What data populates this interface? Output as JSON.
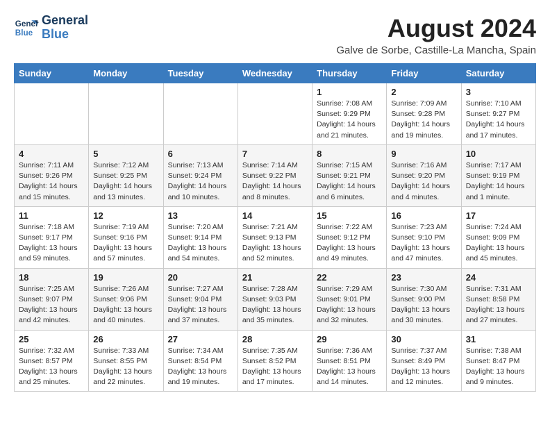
{
  "header": {
    "logo_line1": "General",
    "logo_line2": "Blue",
    "month_year": "August 2024",
    "location": "Galve de Sorbe, Castille-La Mancha, Spain"
  },
  "days_of_week": [
    "Sunday",
    "Monday",
    "Tuesday",
    "Wednesday",
    "Thursday",
    "Friday",
    "Saturday"
  ],
  "weeks": [
    [
      {
        "day": "",
        "content": ""
      },
      {
        "day": "",
        "content": ""
      },
      {
        "day": "",
        "content": ""
      },
      {
        "day": "",
        "content": ""
      },
      {
        "day": "1",
        "content": "Sunrise: 7:08 AM\nSunset: 9:29 PM\nDaylight: 14 hours and 21 minutes."
      },
      {
        "day": "2",
        "content": "Sunrise: 7:09 AM\nSunset: 9:28 PM\nDaylight: 14 hours and 19 minutes."
      },
      {
        "day": "3",
        "content": "Sunrise: 7:10 AM\nSunset: 9:27 PM\nDaylight: 14 hours and 17 minutes."
      }
    ],
    [
      {
        "day": "4",
        "content": "Sunrise: 7:11 AM\nSunset: 9:26 PM\nDaylight: 14 hours and 15 minutes."
      },
      {
        "day": "5",
        "content": "Sunrise: 7:12 AM\nSunset: 9:25 PM\nDaylight: 14 hours and 13 minutes."
      },
      {
        "day": "6",
        "content": "Sunrise: 7:13 AM\nSunset: 9:24 PM\nDaylight: 14 hours and 10 minutes."
      },
      {
        "day": "7",
        "content": "Sunrise: 7:14 AM\nSunset: 9:22 PM\nDaylight: 14 hours and 8 minutes."
      },
      {
        "day": "8",
        "content": "Sunrise: 7:15 AM\nSunset: 9:21 PM\nDaylight: 14 hours and 6 minutes."
      },
      {
        "day": "9",
        "content": "Sunrise: 7:16 AM\nSunset: 9:20 PM\nDaylight: 14 hours and 4 minutes."
      },
      {
        "day": "10",
        "content": "Sunrise: 7:17 AM\nSunset: 9:19 PM\nDaylight: 14 hours and 1 minute."
      }
    ],
    [
      {
        "day": "11",
        "content": "Sunrise: 7:18 AM\nSunset: 9:17 PM\nDaylight: 13 hours and 59 minutes."
      },
      {
        "day": "12",
        "content": "Sunrise: 7:19 AM\nSunset: 9:16 PM\nDaylight: 13 hours and 57 minutes."
      },
      {
        "day": "13",
        "content": "Sunrise: 7:20 AM\nSunset: 9:14 PM\nDaylight: 13 hours and 54 minutes."
      },
      {
        "day": "14",
        "content": "Sunrise: 7:21 AM\nSunset: 9:13 PM\nDaylight: 13 hours and 52 minutes."
      },
      {
        "day": "15",
        "content": "Sunrise: 7:22 AM\nSunset: 9:12 PM\nDaylight: 13 hours and 49 minutes."
      },
      {
        "day": "16",
        "content": "Sunrise: 7:23 AM\nSunset: 9:10 PM\nDaylight: 13 hours and 47 minutes."
      },
      {
        "day": "17",
        "content": "Sunrise: 7:24 AM\nSunset: 9:09 PM\nDaylight: 13 hours and 45 minutes."
      }
    ],
    [
      {
        "day": "18",
        "content": "Sunrise: 7:25 AM\nSunset: 9:07 PM\nDaylight: 13 hours and 42 minutes."
      },
      {
        "day": "19",
        "content": "Sunrise: 7:26 AM\nSunset: 9:06 PM\nDaylight: 13 hours and 40 minutes."
      },
      {
        "day": "20",
        "content": "Sunrise: 7:27 AM\nSunset: 9:04 PM\nDaylight: 13 hours and 37 minutes."
      },
      {
        "day": "21",
        "content": "Sunrise: 7:28 AM\nSunset: 9:03 PM\nDaylight: 13 hours and 35 minutes."
      },
      {
        "day": "22",
        "content": "Sunrise: 7:29 AM\nSunset: 9:01 PM\nDaylight: 13 hours and 32 minutes."
      },
      {
        "day": "23",
        "content": "Sunrise: 7:30 AM\nSunset: 9:00 PM\nDaylight: 13 hours and 30 minutes."
      },
      {
        "day": "24",
        "content": "Sunrise: 7:31 AM\nSunset: 8:58 PM\nDaylight: 13 hours and 27 minutes."
      }
    ],
    [
      {
        "day": "25",
        "content": "Sunrise: 7:32 AM\nSunset: 8:57 PM\nDaylight: 13 hours and 25 minutes."
      },
      {
        "day": "26",
        "content": "Sunrise: 7:33 AM\nSunset: 8:55 PM\nDaylight: 13 hours and 22 minutes."
      },
      {
        "day": "27",
        "content": "Sunrise: 7:34 AM\nSunset: 8:54 PM\nDaylight: 13 hours and 19 minutes."
      },
      {
        "day": "28",
        "content": "Sunrise: 7:35 AM\nSunset: 8:52 PM\nDaylight: 13 hours and 17 minutes."
      },
      {
        "day": "29",
        "content": "Sunrise: 7:36 AM\nSunset: 8:51 PM\nDaylight: 13 hours and 14 minutes."
      },
      {
        "day": "30",
        "content": "Sunrise: 7:37 AM\nSunset: 8:49 PM\nDaylight: 13 hours and 12 minutes."
      },
      {
        "day": "31",
        "content": "Sunrise: 7:38 AM\nSunset: 8:47 PM\nDaylight: 13 hours and 9 minutes."
      }
    ]
  ]
}
